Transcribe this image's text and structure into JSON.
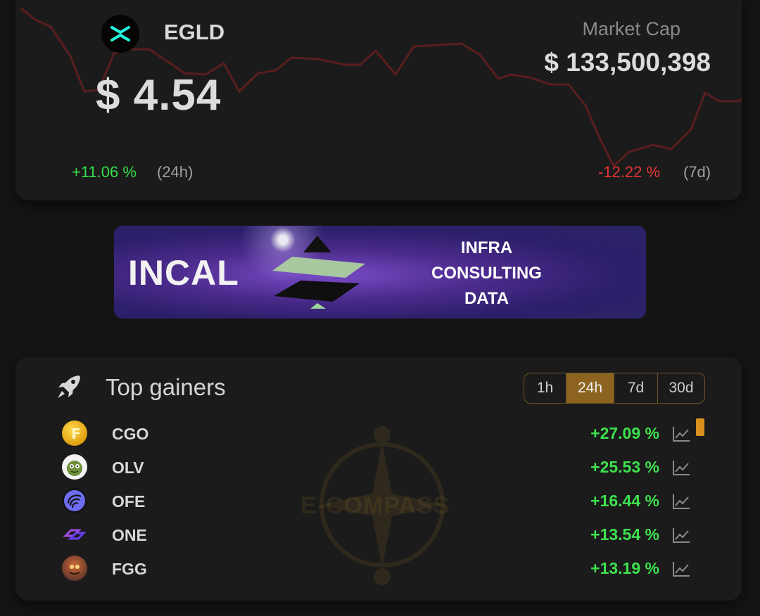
{
  "token": {
    "name": "EGLD",
    "price": "$ 4.54",
    "market_cap_label": "Market Cap",
    "market_cap_value": "$ 133,500,398",
    "change_24h": "+11.06 %",
    "period_24h": "(24h)",
    "change_7d": "-12.22 %",
    "period_7d": "(7d)",
    "logo_icon": "multiversx-x-icon",
    "sparkline_color": "#5a1e1e"
  },
  "banner": {
    "title": "INCAL",
    "lines": [
      "INFRA",
      "CONSULTING",
      "DATA"
    ]
  },
  "gainers": {
    "title": "Top gainers",
    "icon": "rocket-icon",
    "tabs": [
      "1h",
      "24h",
      "7d",
      "30d"
    ],
    "active_tab": "24h",
    "watermark": "E-COMPASS",
    "rows": [
      {
        "symbol": "CGO",
        "change": "+27.09 %"
      },
      {
        "symbol": "OLV",
        "change": "+25.53 %"
      },
      {
        "symbol": "OFE",
        "change": "+16.44 %"
      },
      {
        "symbol": "ONE",
        "change": "+13.54 %"
      },
      {
        "symbol": "FGG",
        "change": "+13.19 %"
      }
    ]
  },
  "colors": {
    "positive": "#3ee24e",
    "negative": "#e53535",
    "accent": "#8c6420"
  }
}
